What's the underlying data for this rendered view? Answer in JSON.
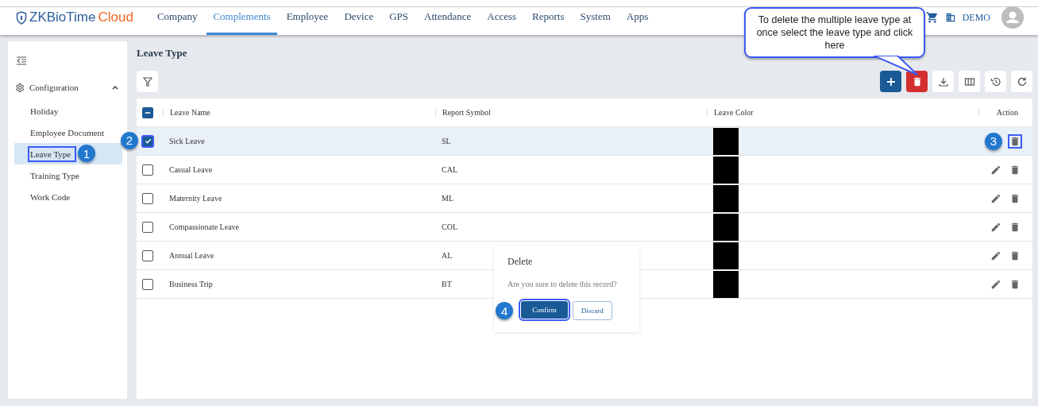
{
  "header": {
    "logo_prefix": "ZKBioTime",
    "logo_suffix": "Cloud",
    "nav": [
      {
        "label": "Company",
        "selected": false
      },
      {
        "label": "Complements",
        "selected": true
      },
      {
        "label": "Employee",
        "selected": false
      },
      {
        "label": "Device",
        "selected": false
      },
      {
        "label": "GPS",
        "selected": false
      },
      {
        "label": "Attendance",
        "selected": false
      },
      {
        "label": "Access",
        "selected": false
      },
      {
        "label": "Reports",
        "selected": false
      },
      {
        "label": "System",
        "selected": false
      },
      {
        "label": "Apps",
        "selected": false
      }
    ],
    "company": "DEMO"
  },
  "callout": {
    "text": "To delete the multiple leave type at once select the leave type and click here"
  },
  "sidebar": {
    "group": {
      "label": "Configuration",
      "expanded": true
    },
    "items": [
      {
        "label": "Holiday",
        "selected": false,
        "highlighted": false
      },
      {
        "label": "Employee Document",
        "selected": false,
        "highlighted": false
      },
      {
        "label": "Leave Type",
        "selected": true,
        "highlighted": true,
        "badge": "1"
      },
      {
        "label": "Training Type",
        "selected": false,
        "highlighted": false
      },
      {
        "label": "Work Code",
        "selected": false,
        "highlighted": false
      }
    ]
  },
  "page_title": "Leave Type",
  "table": {
    "columns": [
      "Leave Name",
      "Report Symbol",
      "Leave Color",
      "Action"
    ],
    "some_checked": true,
    "rows": [
      {
        "name": "Sick Leave",
        "symbol": "SL",
        "color": "#000000",
        "checked": true,
        "highlighted": true,
        "badge": "2",
        "action_badge": "3"
      },
      {
        "name": "Casual Leave",
        "symbol": "CAL",
        "color": "#000000",
        "checked": false
      },
      {
        "name": "Maternity Leave",
        "symbol": "ML",
        "color": "#000000",
        "checked": false
      },
      {
        "name": "Compassionate Leave",
        "symbol": "COL",
        "color": "#000000",
        "checked": false
      },
      {
        "name": "Annual Leave",
        "symbol": "AL",
        "color": "#000000",
        "checked": false
      },
      {
        "name": "Business Trip",
        "symbol": "BT",
        "color": "#000000",
        "checked": false
      }
    ]
  },
  "dialog": {
    "title": "Delete",
    "message": "Are you sure to delete this record?",
    "confirm": "Confirm",
    "discard": "Discard",
    "confirm_badge": "4"
  }
}
